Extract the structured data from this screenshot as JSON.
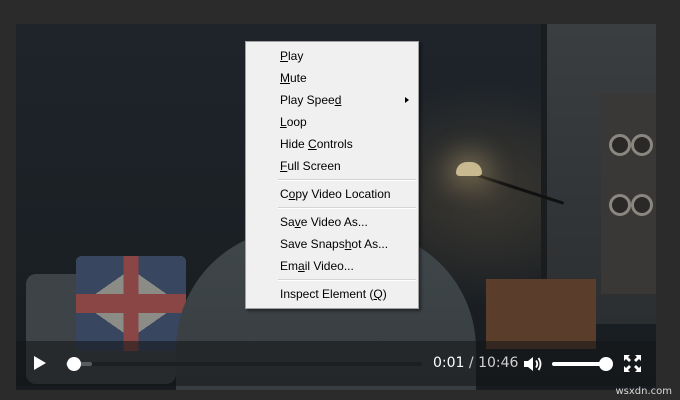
{
  "player": {
    "current_time": "0:01",
    "separator": "/",
    "duration": "10:46",
    "progress_fraction": 0.002,
    "volume_fraction": 1.0
  },
  "context_menu": {
    "items": [
      {
        "label_pre": "",
        "label_u": "P",
        "label_post": "lay",
        "has_submenu": false
      },
      {
        "label_pre": "",
        "label_u": "M",
        "label_post": "ute",
        "has_submenu": false
      },
      {
        "label_pre": "Play Spee",
        "label_u": "d",
        "label_post": "",
        "has_submenu": true
      },
      {
        "label_pre": "",
        "label_u": "L",
        "label_post": "oop",
        "has_submenu": false
      },
      {
        "label_pre": "Hide ",
        "label_u": "C",
        "label_post": "ontrols",
        "has_submenu": false
      },
      {
        "label_pre": "",
        "label_u": "F",
        "label_post": "ull Screen",
        "has_submenu": false
      },
      {
        "label_pre": "C",
        "label_u": "o",
        "label_post": "py Video Location",
        "has_submenu": false
      },
      {
        "label_pre": "Sa",
        "label_u": "v",
        "label_post": "e Video As...",
        "has_submenu": false
      },
      {
        "label_pre": "Save Snaps",
        "label_u": "h",
        "label_post": "ot As...",
        "has_submenu": false
      },
      {
        "label_pre": "Em",
        "label_u": "a",
        "label_post": "il Video...",
        "has_submenu": false
      },
      {
        "label_pre": "Inspect Element (",
        "label_u": "Q",
        "label_post": ")",
        "has_submenu": false
      }
    ]
  },
  "watermark": "wsxdn.com",
  "icons": {
    "play": "play-icon",
    "volume": "volume-icon",
    "fullscreen": "fullscreen-icon",
    "submenu": "chevron-right-icon"
  }
}
